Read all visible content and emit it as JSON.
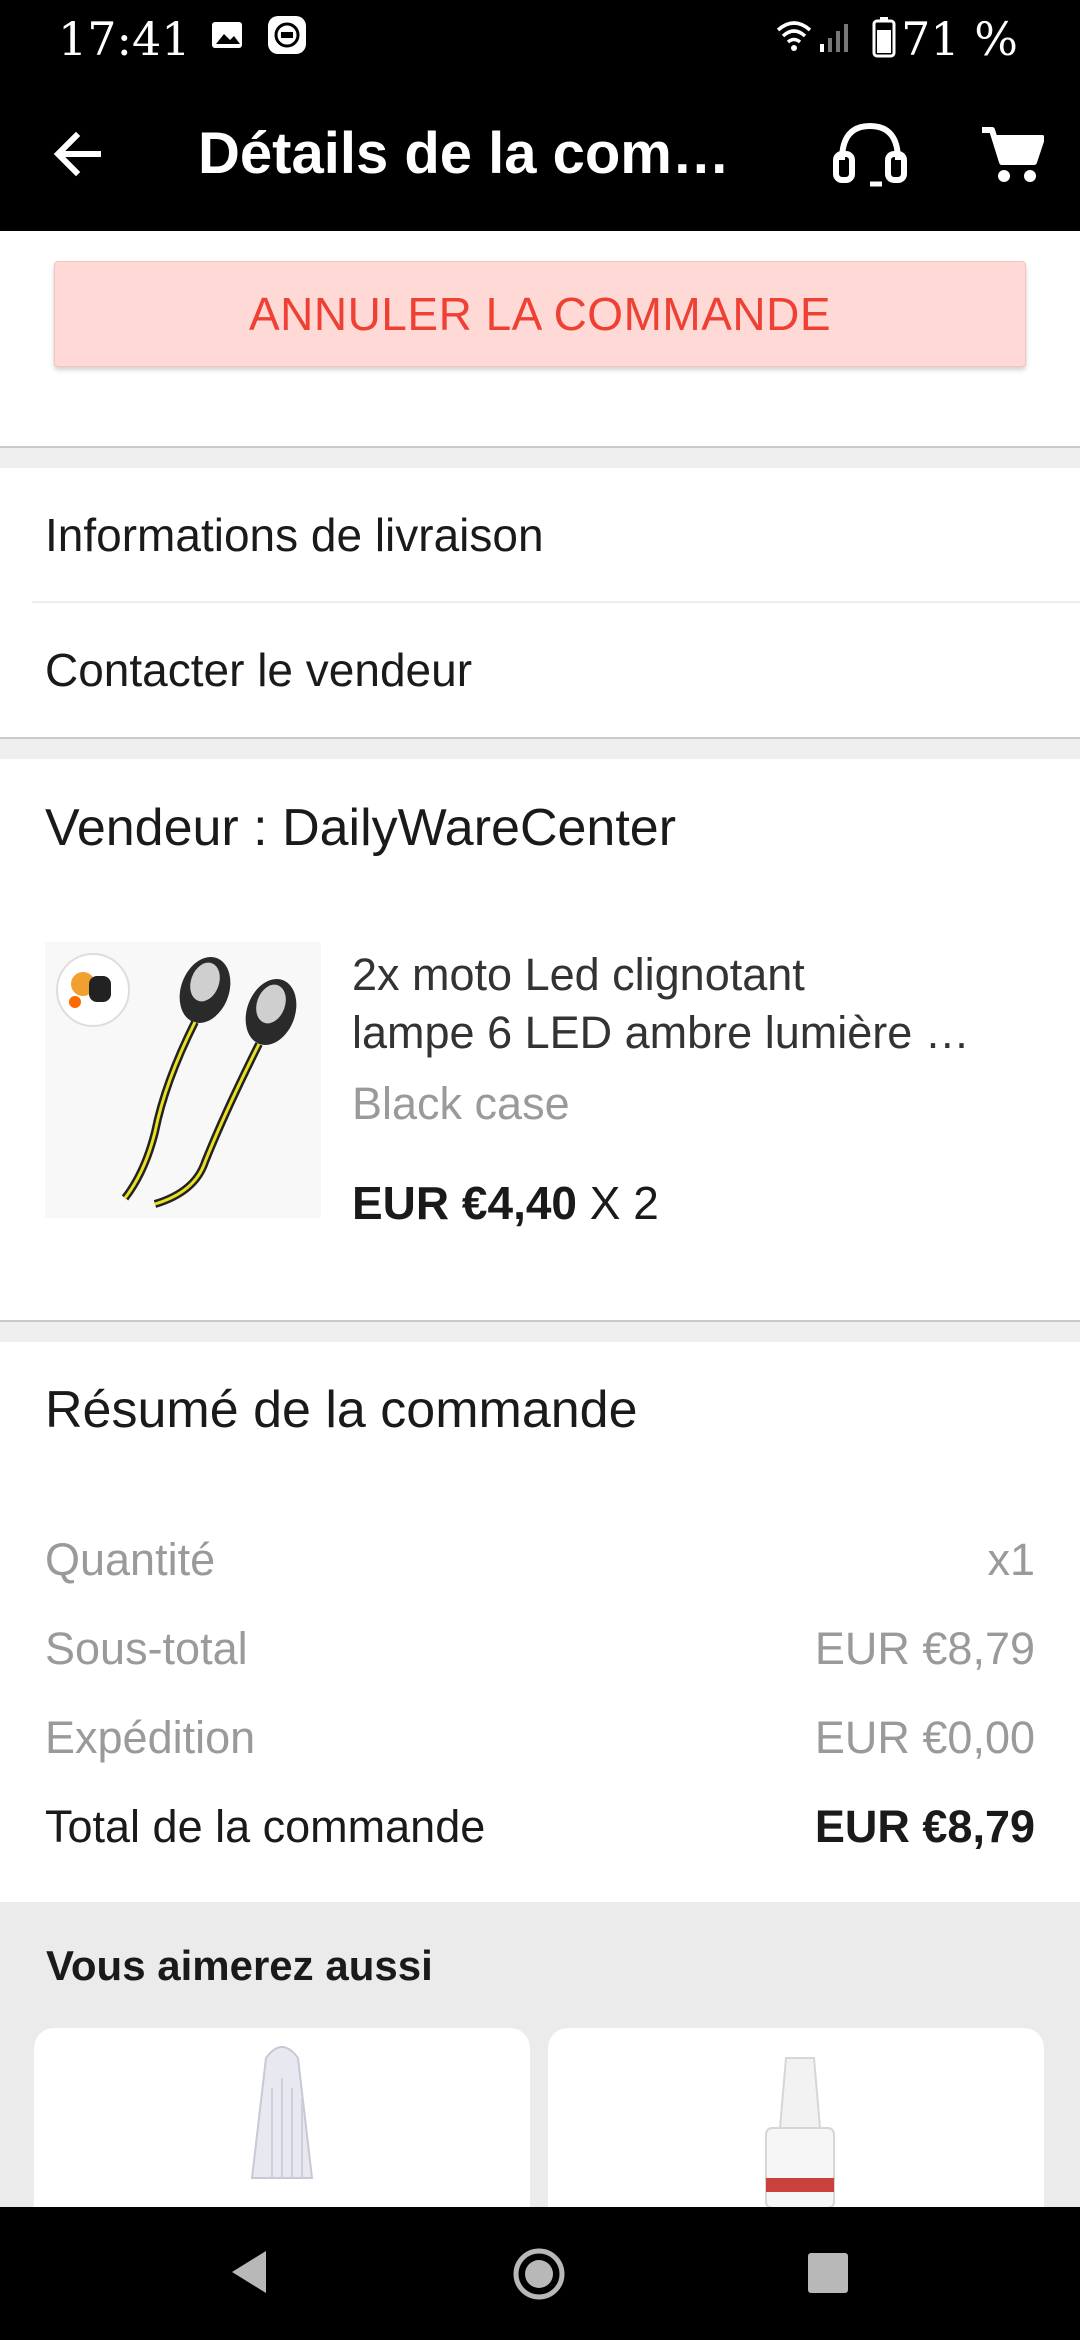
{
  "status_bar": {
    "time": "17:41",
    "battery_percent": "71 %"
  },
  "app_bar": {
    "title": "Détails de la com…"
  },
  "actions": {
    "cancel_label": "ANNULER LA COMMANDE"
  },
  "menu": {
    "delivery_info": "Informations de livraison",
    "contact_seller": "Contacter le vendeur"
  },
  "seller": {
    "label": "Vendeur : DailyWareCenter"
  },
  "product": {
    "name_line1": "2x moto Led clignotant",
    "name_line2": "lampe 6 LED ambre lumière …",
    "variant": "Black case",
    "price": "EUR €4,40",
    "quantity": " X 2"
  },
  "summary": {
    "title": "Résumé de la commande",
    "rows": [
      {
        "label": "Quantité",
        "value": "x1"
      },
      {
        "label": "Sous-total",
        "value": "EUR €8,79"
      },
      {
        "label": "Expédition",
        "value": "EUR €0,00"
      }
    ],
    "total": {
      "label": "Total de la commande",
      "value": "EUR €8,79"
    }
  },
  "recommendations": {
    "title": "Vous aimerez aussi"
  },
  "icons": {
    "back": "arrow-left-icon",
    "support": "headset-icon",
    "cart": "cart-icon"
  },
  "colors": {
    "cancel_bg": "#ffd9d6",
    "cancel_text": "#ef4034",
    "bar_bg": "#000000"
  }
}
